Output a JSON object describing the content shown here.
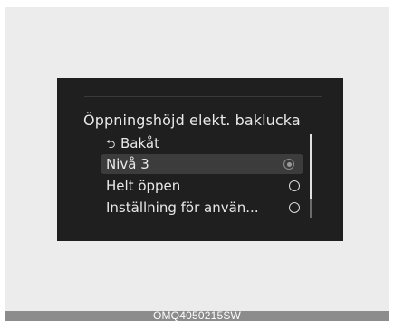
{
  "screen": {
    "title": "Öppningshöjd elekt. baklucka",
    "back_label": "Bakåt",
    "items": [
      {
        "label": "Nivå 3",
        "selected": true
      },
      {
        "label": "Helt öppen",
        "selected": false
      },
      {
        "label": "Inställning för använ...",
        "selected": false
      }
    ],
    "scroll_fraction_visible": 0.78
  },
  "caption": {
    "code": "OMQ4050215SW"
  },
  "colors": {
    "screen_background": "#1f1f1f",
    "text": "#e8e8e8",
    "highlight": "#3c3c3c"
  },
  "icons": {
    "back": "back-arrow-icon",
    "radio": "radio-button-icon"
  }
}
